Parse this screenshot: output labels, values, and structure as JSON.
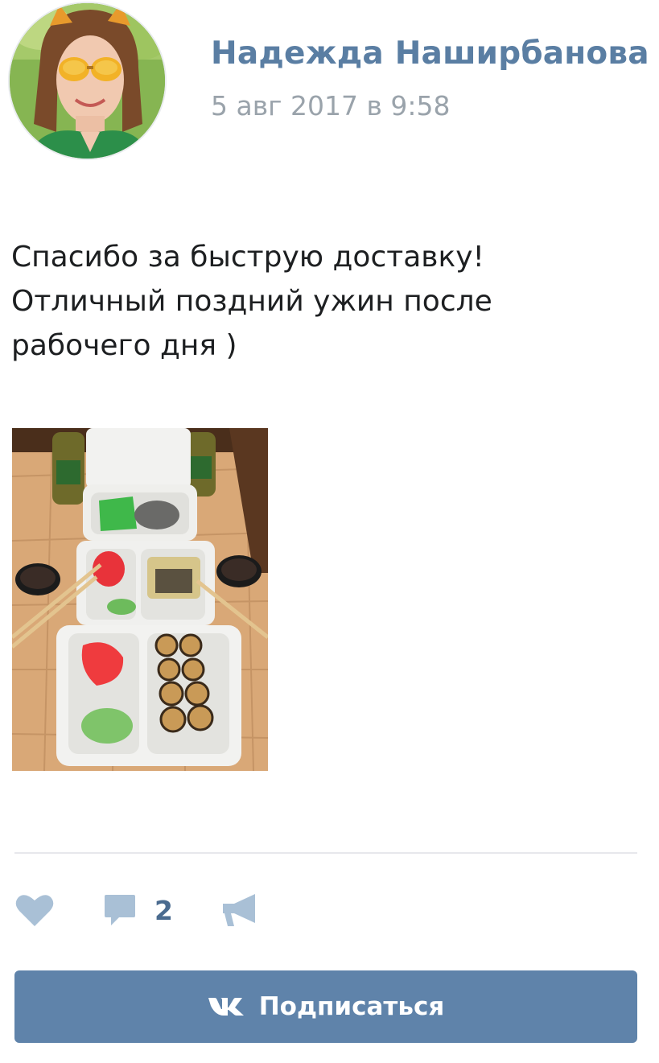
{
  "author": {
    "name": "Надежда Наширбанова",
    "date": "5 авг 2017 в 9:58"
  },
  "post": {
    "text_lines": [
      "Спасибо за быструю доставку!",
      "Отличный поздний ужин после",
      "рабочего дня )"
    ]
  },
  "actions": {
    "like_icon": "heart-icon",
    "comment_icon": "comment-icon",
    "comment_count": "2",
    "share_icon": "megaphone-icon",
    "icon_color": "#a9c0d6"
  },
  "subscribe": {
    "label": "Подписаться",
    "logo": "vk-logo",
    "background": "#5f83aa"
  },
  "colors": {
    "name_link": "#5a7ea3",
    "date_text": "#9aa3ab",
    "divider": "#e7e8ec"
  }
}
